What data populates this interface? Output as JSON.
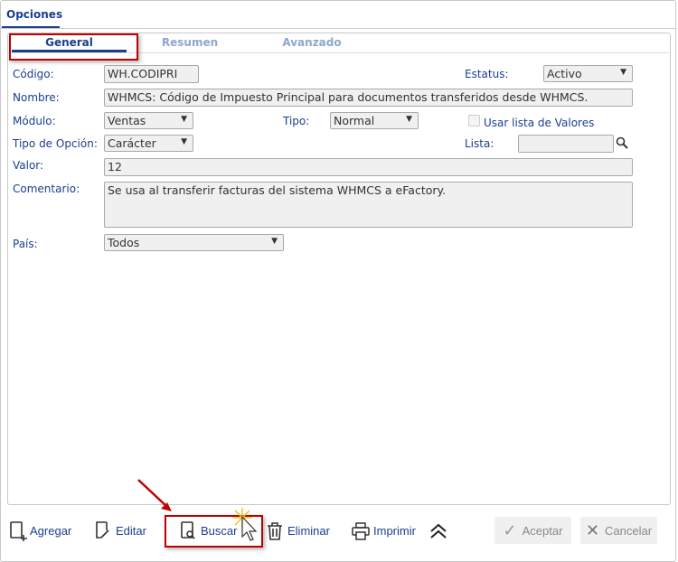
{
  "main_tab": "Opciones",
  "subtabs": [
    "General",
    "Resumen",
    "Avanzado"
  ],
  "form": {
    "codigo_label": "Código:",
    "codigo": "WH.CODIPRI",
    "estatus_label": "Estatus:",
    "estatus": "Activo",
    "nombre_label": "Nombre:",
    "nombre": "WHMCS: Código de Impuesto Principal para documentos transferidos desde WHMCS.",
    "modulo_label": "Módulo:",
    "modulo": "Ventas",
    "tipo_label": "Tipo:",
    "tipo": "Normal",
    "usar_lista_label": "Usar lista de Valores",
    "tipo_opcion_label": "Tipo de Opción:",
    "tipo_opcion": "Carácter",
    "lista_label": "Lista:",
    "lista": "",
    "valor_label": "Valor:",
    "valor": "12",
    "comentario_label": "Comentario:",
    "comentario": "Se usa al transferir facturas del sistema WHMCS a eFactory.",
    "pais_label": "País:",
    "pais": "Todos"
  },
  "toolbar": {
    "agregar": "Agregar",
    "editar": "Editar",
    "buscar": "Buscar",
    "eliminar": "Eliminar",
    "imprimir": "Imprimir",
    "aceptar": "Aceptar",
    "cancelar": "Cancelar"
  },
  "colors": {
    "accent": "#1a3f8f",
    "highlight": "#c00000"
  }
}
